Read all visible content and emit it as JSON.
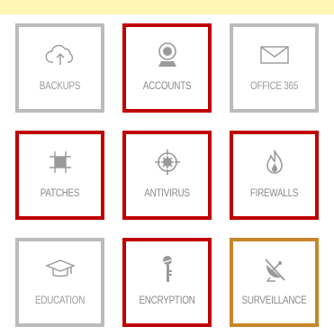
{
  "colors": {
    "background": "#fffdd0",
    "banner": "#fff6b5",
    "panel": "#ffffff",
    "border_default": "#bbbbbb",
    "border_highlight_red": "#c00000",
    "border_highlight_orange": "#c8862a",
    "icon": "#9a9a9a",
    "label": "#9a9a9a"
  },
  "tiles": [
    {
      "label": "BACKUPS",
      "icon": "cloud-upload-icon",
      "highlight": "none"
    },
    {
      "label": "ACCOUNTS",
      "icon": "webcam-icon",
      "highlight": "red"
    },
    {
      "label": "OFFICE 365",
      "icon": "envelope-icon",
      "highlight": "none"
    },
    {
      "label": "PATCHES",
      "icon": "patch-icon",
      "highlight": "red"
    },
    {
      "label": "ANTIVIRUS",
      "icon": "virus-target-icon",
      "highlight": "red"
    },
    {
      "label": "FIREWALLS",
      "icon": "flame-icon",
      "highlight": "red"
    },
    {
      "label": "EDUCATION",
      "icon": "graduation-cap-icon",
      "highlight": "none"
    },
    {
      "label": "ENCRYPTION",
      "icon": "key-icon",
      "highlight": "red"
    },
    {
      "label": "SURVEILLANCE",
      "icon": "satellite-dish-icon",
      "highlight": "orange"
    }
  ]
}
